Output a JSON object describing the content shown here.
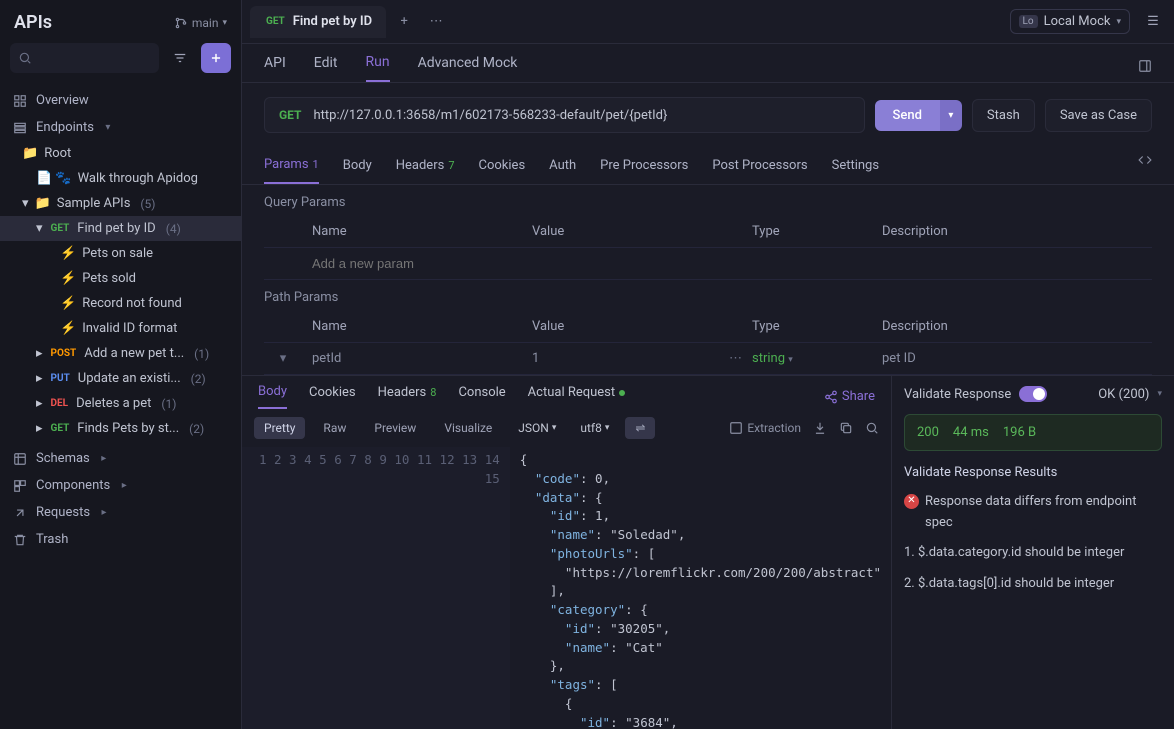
{
  "sidebar": {
    "title": "APIs",
    "branch": "main",
    "overview": "Overview",
    "endpoints": "Endpoints",
    "root": "Root",
    "walk": "Walk through Apidog",
    "sample_apis": "Sample APIs",
    "sample_count": "(5)",
    "items": [
      {
        "method": "GET",
        "name": "Find pet by ID",
        "count": "(4)"
      },
      {
        "method": "",
        "name": "Pets on sale",
        "lightning": true
      },
      {
        "method": "",
        "name": "Pets sold",
        "lightning": true
      },
      {
        "method": "",
        "name": "Record not found",
        "lightning": true
      },
      {
        "method": "",
        "name": "Invalid ID format",
        "lightning": true
      },
      {
        "method": "POST",
        "name": "Add a new pet t...",
        "count": "(1)"
      },
      {
        "method": "PUT",
        "name": "Update an existi...",
        "count": "(2)"
      },
      {
        "method": "DEL",
        "name": "Deletes a pet",
        "count": "(1)"
      },
      {
        "method": "GET",
        "name": "Finds Pets by st...",
        "count": "(2)"
      }
    ],
    "schemas": "Schemas",
    "components": "Components",
    "requests": "Requests",
    "trash": "Trash"
  },
  "tab": {
    "method": "GET",
    "title": "Find pet by ID",
    "env_badge": "Lo",
    "env": "Local Mock"
  },
  "subtabs": [
    "API",
    "Edit",
    "Run",
    "Advanced Mock"
  ],
  "request": {
    "method": "GET",
    "url": "http://127.0.0.1:3658/m1/602173-568233-default/pet/{petId}",
    "send": "Send",
    "stash": "Stash",
    "savecase": "Save as Case"
  },
  "reqtabs": {
    "params": "Params",
    "params_n": "1",
    "body": "Body",
    "headers": "Headers",
    "headers_n": "7",
    "cookies": "Cookies",
    "auth": "Auth",
    "pre": "Pre Processors",
    "post": "Post Processors",
    "settings": "Settings"
  },
  "params": {
    "query_label": "Query Params",
    "path_label": "Path Params",
    "cols": {
      "name": "Name",
      "value": "Value",
      "type": "Type",
      "desc": "Description"
    },
    "add_placeholder": "Add a new param",
    "path_rows": [
      {
        "name": "petId",
        "value": "1",
        "type": "string",
        "desc": "pet ID"
      }
    ]
  },
  "resp": {
    "tabs": {
      "body": "Body",
      "cookies": "Cookies",
      "headers": "Headers",
      "headers_n": "8",
      "console": "Console",
      "actual": "Actual Request"
    },
    "share": "Share",
    "fmt": {
      "pretty": "Pretty",
      "raw": "Raw",
      "preview": "Preview",
      "visualize": "Visualize",
      "json": "JSON",
      "utf8": "utf8",
      "extraction": "Extraction"
    },
    "lines": 15
  },
  "jsonbody": [
    "{",
    "  \"code\": 0,",
    "  \"data\": {",
    "    \"id\": 1,",
    "    \"name\": \"Soledad\",",
    "    \"photoUrls\": [",
    "      \"https://loremflickr.com/200/200/abstract\"",
    "    ],",
    "    \"category\": {",
    "      \"id\": \"30205\",",
    "      \"name\": \"Cat\"",
    "    },",
    "    \"tags\": [",
    "      {",
    "        \"id\": \"3684\","
  ],
  "validate": {
    "label": "Validate Response",
    "status": "OK (200)",
    "stats": {
      "code": "200",
      "time": "44 ms",
      "size": "196 B"
    },
    "results_title": "Validate Response Results",
    "error": "Response data differs from endpoint spec",
    "rules": [
      "1. $.data.category.id should be integer",
      "2. $.data.tags[0].id should be integer"
    ]
  }
}
